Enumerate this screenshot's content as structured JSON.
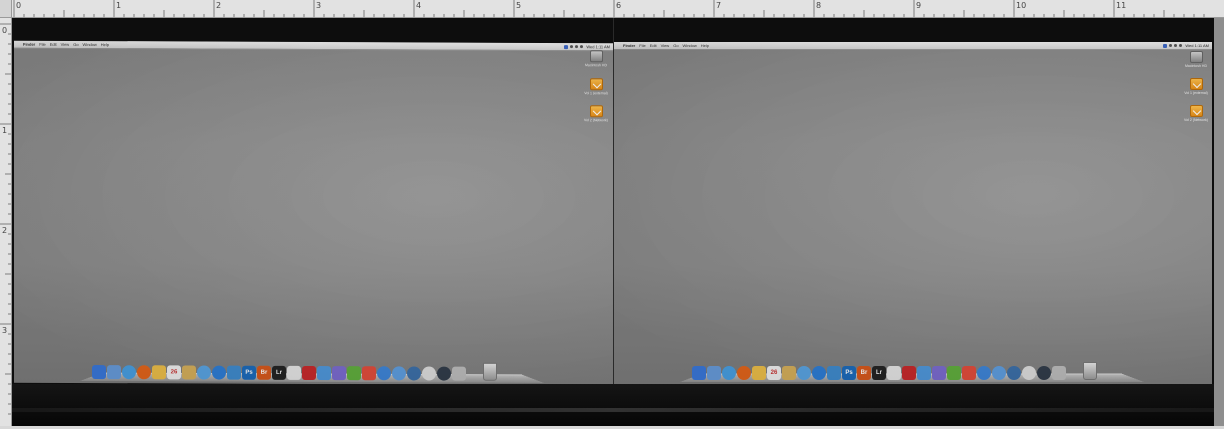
{
  "ruler": {
    "top_numbers": [
      "0",
      "1",
      "2",
      "3",
      "4",
      "5",
      "6",
      "7",
      "8",
      "9",
      "10",
      "11"
    ],
    "left_numbers": [
      "0",
      "1",
      "2",
      "3"
    ]
  },
  "screens": [
    {
      "menu_items": [
        "Finder",
        "File",
        "Edit",
        "View",
        "Go",
        "Window",
        "Help"
      ],
      "clock": "Wed 1:11 AM",
      "desktop_icons": [
        {
          "label": "Macintosh HD",
          "icon": "hard-drive-icon"
        },
        {
          "label": "Vol 1 (external)",
          "icon": "external-volume-icon"
        },
        {
          "label": "Vol 2 (Network)",
          "icon": "external-volume-icon"
        }
      ]
    },
    {
      "menu_items": [
        "Finder",
        "File",
        "Edit",
        "View",
        "Go",
        "Window",
        "Help"
      ],
      "clock": "Wed 1:11 AM",
      "desktop_icons": [
        {
          "label": "Macintosh HD",
          "icon": "hard-drive-icon"
        },
        {
          "label": "Vol 1 (external)",
          "icon": "external-volume-icon"
        },
        {
          "label": "Vol 2 (Network)",
          "icon": "external-volume-icon"
        }
      ]
    }
  ],
  "dock": {
    "icons": [
      {
        "name": "finder-icon",
        "color": "#3b7be0",
        "text": ""
      },
      {
        "name": "mail-icon",
        "color": "#6a9fe0",
        "text": ""
      },
      {
        "name": "safari-icon",
        "color": "#4aa3e8",
        "text": ""
      },
      {
        "name": "firefox-icon",
        "color": "#e8671c",
        "text": ""
      },
      {
        "name": "notes-icon",
        "color": "#f1c24a",
        "text": ""
      },
      {
        "name": "calendar-icon",
        "color": "#f3f3f3",
        "text": "26"
      },
      {
        "name": "preview-icon",
        "color": "#d9b25c",
        "text": ""
      },
      {
        "name": "network-icon",
        "color": "#5aa6e6",
        "text": ""
      },
      {
        "name": "app-store-icon",
        "color": "#2d7ed8",
        "text": ""
      },
      {
        "name": "iphoto-icon",
        "color": "#3f8cd0",
        "text": ""
      },
      {
        "name": "photoshop-icon",
        "color": "#1b6bbd",
        "text": "Ps"
      },
      {
        "name": "bridge-icon",
        "color": "#d9581b",
        "text": "Br"
      },
      {
        "name": "lightroom-icon",
        "color": "#222222",
        "text": "Lr"
      },
      {
        "name": "screen-icon",
        "color": "#e6e6e6",
        "text": ""
      },
      {
        "name": "acrobat-icon",
        "color": "#c8272a",
        "text": ""
      },
      {
        "name": "wireless-icon",
        "color": "#4e97dc",
        "text": ""
      },
      {
        "name": "pen-tool-icon",
        "color": "#7a6ad0",
        "text": ""
      },
      {
        "name": "leaf-icon",
        "color": "#5fae3c",
        "text": ""
      },
      {
        "name": "palette-icon",
        "color": "#e24b3a",
        "text": ""
      },
      {
        "name": "itunes-icon",
        "color": "#3c84d8",
        "text": ""
      },
      {
        "name": "facetime-icon",
        "color": "#5d9de0",
        "text": ""
      },
      {
        "name": "browser-icon",
        "color": "#3a6ea8",
        "text": ""
      },
      {
        "name": "clock-icon",
        "color": "#dddddd",
        "text": ""
      },
      {
        "name": "quicktime-icon",
        "color": "#2f3a48",
        "text": ""
      },
      {
        "name": "utilities-icon",
        "color": "#bcbcbc",
        "text": ""
      }
    ]
  }
}
